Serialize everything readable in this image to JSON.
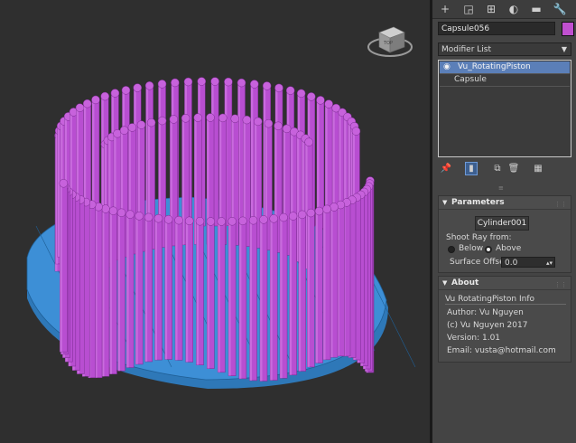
{
  "viewport": {
    "gizmo_label": "TOP",
    "colors": {
      "background": "#2f2f2f",
      "pistons": "#b84ed1",
      "base": "#3d8fd6"
    }
  },
  "tabs": [
    {
      "name": "create-tab",
      "glyph": "+"
    },
    {
      "name": "modify-tab",
      "glyph": "◲"
    },
    {
      "name": "hierarchy-tab",
      "glyph": "⊞"
    },
    {
      "name": "motion-tab",
      "glyph": "◐"
    },
    {
      "name": "display-tab",
      "glyph": "▬"
    },
    {
      "name": "utilities-tab",
      "glyph": "🔧"
    }
  ],
  "object": {
    "name": "Capsule056",
    "color": "#c050d0"
  },
  "modifier_list": {
    "label": "Modifier List"
  },
  "stack": [
    {
      "label": "Vu_RotatingPiston",
      "selected": true,
      "eye_icon": "◉"
    },
    {
      "label": "Capsule",
      "selected": false
    }
  ],
  "stack_toolbar": [
    {
      "name": "pin-stack-icon",
      "glyph": "📌"
    },
    {
      "name": "show-end-result-icon",
      "glyph": "▮",
      "active": true
    },
    {
      "name": "make-unique-icon",
      "glyph": "⧉"
    },
    {
      "name": "remove-modifier-icon",
      "glyph": "🗑"
    },
    {
      "name": "configure-sets-icon",
      "glyph": "▦"
    }
  ],
  "parameters": {
    "title": "Parameters",
    "pick_button": "Cylinder001",
    "shoot_ray_label": "Shoot Ray from:",
    "below_label": "Below",
    "above_label": "Above",
    "selected_direction": "above",
    "surface_offset_label": "Surface Offset",
    "surface_offset_value": "0.0"
  },
  "about": {
    "title": "About",
    "group_title": "Vu RotatingPiston Info",
    "author": "Author: Vu Nguyen",
    "copyright": "(c) Vu Nguyen 2017",
    "version": "Version: 1.01",
    "email": "Email: vusta@hotmail.com"
  }
}
